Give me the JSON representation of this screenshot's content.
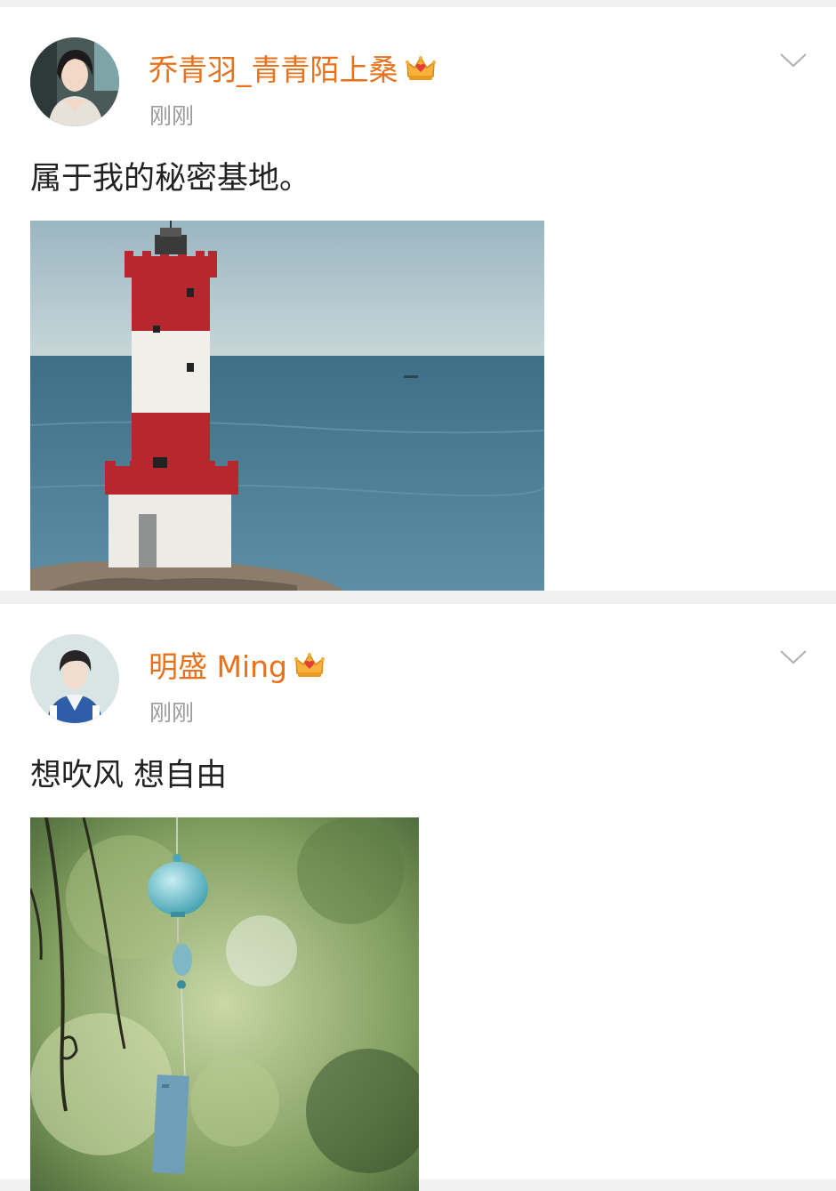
{
  "posts": [
    {
      "username": "乔青羽_青青陌上桑",
      "timestamp": "刚刚",
      "text": "属于我的秘密基地。",
      "image_icon": "lighthouse-photo"
    },
    {
      "username": "明盛 Ming",
      "timestamp": "刚刚",
      "text": "想吹风 想自由",
      "image_icon": "wind-chime-photo"
    }
  ],
  "colors": {
    "username": "#e8721c",
    "timestamp": "#9b9b9b",
    "text": "#222222",
    "separator": "#f1f1f1"
  },
  "icons": {
    "crown": "crown-badge-icon",
    "menu": "chevron-down-icon"
  }
}
